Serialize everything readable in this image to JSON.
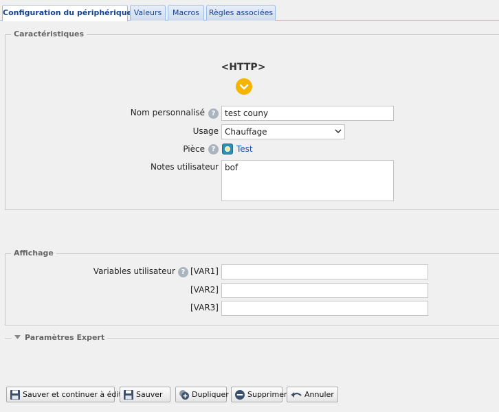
{
  "tabs": [
    {
      "label": "Configuration du périphérique",
      "active": true
    },
    {
      "label": "Valeurs",
      "active": false
    },
    {
      "label": "Macros",
      "active": false
    },
    {
      "label": "Règles associées",
      "active": false
    }
  ],
  "characteristics": {
    "legend": "Caractéristiques",
    "device_type": "<HTTP>",
    "name_label": "Nom personnalisé",
    "name_value": "test couny",
    "usage_label": "Usage",
    "usage_value": "Chauffage",
    "room_label": "Pièce",
    "room_value": "Test",
    "notes_label": "Notes utilisateur",
    "notes_value": "bof"
  },
  "display": {
    "legend": "Affichage",
    "vars_label": "Variables utilisateur",
    "vars": [
      {
        "tag": "[VAR1]",
        "value": ""
      },
      {
        "tag": "[VAR2]",
        "value": ""
      },
      {
        "tag": "[VAR3]",
        "value": ""
      }
    ]
  },
  "expert": {
    "legend": "Paramètres Expert"
  },
  "buttons": {
    "save_continue": "Sauver et continuer à éditer",
    "save": "Sauver",
    "duplicate": "Dupliquer",
    "delete": "Supprimer",
    "cancel": "Annuler"
  },
  "colors": {
    "accent": "#f5b400",
    "tab_text": "#15428b",
    "link": "#1a56a8"
  }
}
